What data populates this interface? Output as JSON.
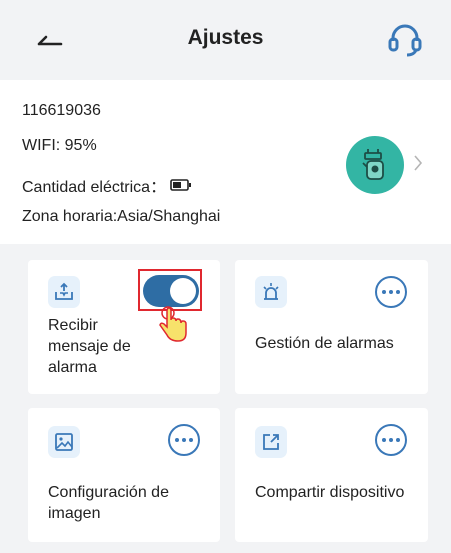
{
  "header": {
    "title": "Ajustes"
  },
  "device": {
    "id": "116619036",
    "wifi": "WIFI:  95%",
    "battery_label": "Cantidad eléctrica：",
    "timezone": "Zona horaria:Asia/Shanghai"
  },
  "cards": {
    "alarm_message": {
      "label": "Recibir mensaje de alarma",
      "toggle_on": true
    },
    "alarm_management": {
      "label": "Gestión de alarmas"
    },
    "image_config": {
      "label": "Configuración de imagen"
    },
    "share_device": {
      "label": "Compartir dispositivo"
    }
  },
  "colors": {
    "accent": "#2e6da4",
    "avatar": "#33b5a4",
    "highlight": "#e0282f"
  },
  "icons": [
    "back-arrow-icon",
    "headset-icon",
    "camera-icon",
    "chevron-right-icon",
    "inbox-upload-icon",
    "alarm-light-icon",
    "image-icon",
    "share-icon",
    "more-icon",
    "hand-pointer-icon"
  ]
}
